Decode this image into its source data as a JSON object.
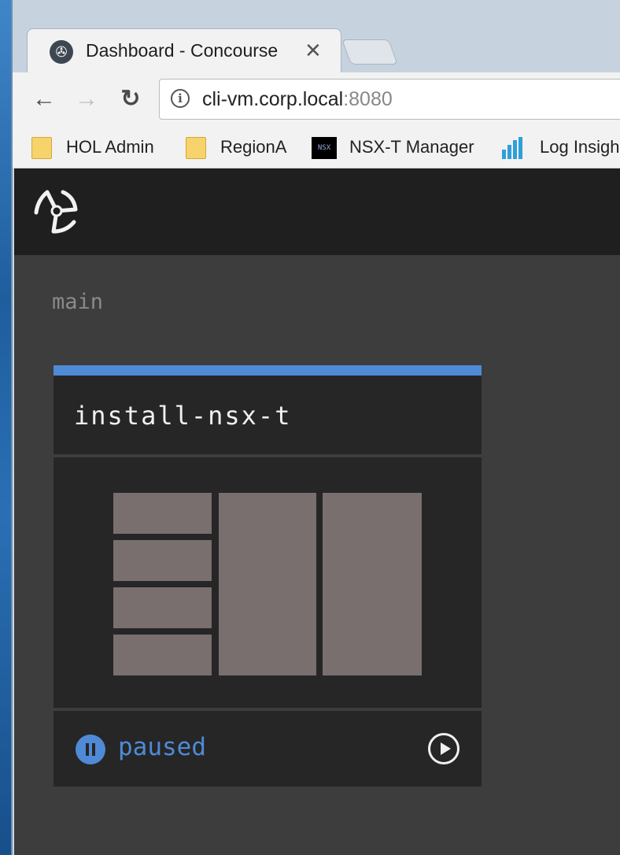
{
  "browser": {
    "tab": {
      "title": "Dashboard - Concourse",
      "close_glyph": "✕",
      "favicon": "concourse-icon"
    },
    "toolbar": {
      "back_glyph": "←",
      "forward_glyph": "→",
      "reload_glyph": "↻",
      "info_glyph": "i"
    },
    "address": {
      "host": "cli-vm.corp.local",
      "port": ":8080"
    },
    "bookmarks": [
      {
        "label": "HOL Admin",
        "icon": "folder-icon"
      },
      {
        "label": "RegionA",
        "icon": "folder-icon"
      },
      {
        "label": "NSX-T Manager",
        "icon": "nsx-icon",
        "icon_text": "NSX"
      },
      {
        "label": "Log Insigh",
        "icon": "bar-chart-icon"
      }
    ]
  },
  "concourse": {
    "team": "main",
    "pipeline": {
      "name": "install-nsx-t",
      "status": "paused",
      "accent_color": "#4f8ad6"
    }
  }
}
